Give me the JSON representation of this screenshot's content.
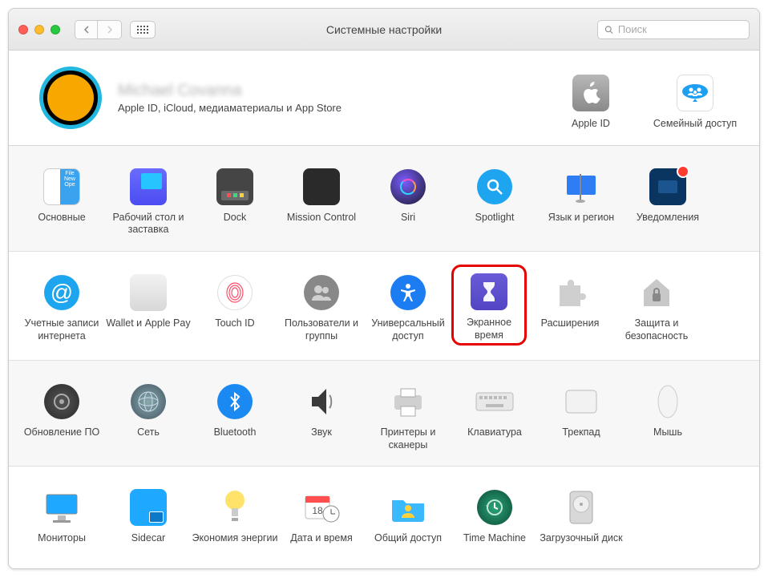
{
  "window": {
    "title": "Системные настройки"
  },
  "search": {
    "placeholder": "Поиск"
  },
  "account": {
    "name": "Michael Covanna",
    "subtitle": "Apple ID, iCloud, медиаматериалы и App Store",
    "appleid_label": "Apple ID",
    "family_label": "Семейный доступ"
  },
  "rows": [
    [
      {
        "id": "general",
        "label": "Основные"
      },
      {
        "id": "desktop",
        "label": "Рабочий стол и заставка"
      },
      {
        "id": "dock",
        "label": "Dock"
      },
      {
        "id": "mission",
        "label": "Mission Control"
      },
      {
        "id": "siri",
        "label": "Siri"
      },
      {
        "id": "spotlight",
        "label": "Spotlight"
      },
      {
        "id": "language",
        "label": "Язык и регион"
      },
      {
        "id": "notifications",
        "label": "Уведомления"
      }
    ],
    [
      {
        "id": "internet",
        "label": "Учетные записи интернета"
      },
      {
        "id": "wallet",
        "label": "Wallet и Apple Pay"
      },
      {
        "id": "touchid",
        "label": "Touch ID"
      },
      {
        "id": "users",
        "label": "Пользователи и группы"
      },
      {
        "id": "access",
        "label": "Универсальный доступ"
      },
      {
        "id": "screentime",
        "label": "Экранное время",
        "highlight": true
      },
      {
        "id": "extensions",
        "label": "Расширения"
      },
      {
        "id": "security",
        "label": "Защита и безопасность"
      }
    ],
    [
      {
        "id": "update",
        "label": "Обновление ПО"
      },
      {
        "id": "network",
        "label": "Сеть"
      },
      {
        "id": "bluetooth",
        "label": "Bluetooth"
      },
      {
        "id": "sound",
        "label": "Звук"
      },
      {
        "id": "printers",
        "label": "Принтеры и сканеры"
      },
      {
        "id": "keyboard",
        "label": "Клавиатура"
      },
      {
        "id": "trackpad",
        "label": "Трекпад"
      },
      {
        "id": "mouse",
        "label": "Мышь"
      }
    ],
    [
      {
        "id": "displays",
        "label": "Мониторы"
      },
      {
        "id": "sidecar",
        "label": "Sidecar"
      },
      {
        "id": "energy",
        "label": "Экономия энергии"
      },
      {
        "id": "datetime",
        "label": "Дата и время"
      },
      {
        "id": "sharing",
        "label": "Общий доступ"
      },
      {
        "id": "timemachine",
        "label": "Time Machine"
      },
      {
        "id": "startup",
        "label": "Загрузочный диск"
      }
    ]
  ]
}
